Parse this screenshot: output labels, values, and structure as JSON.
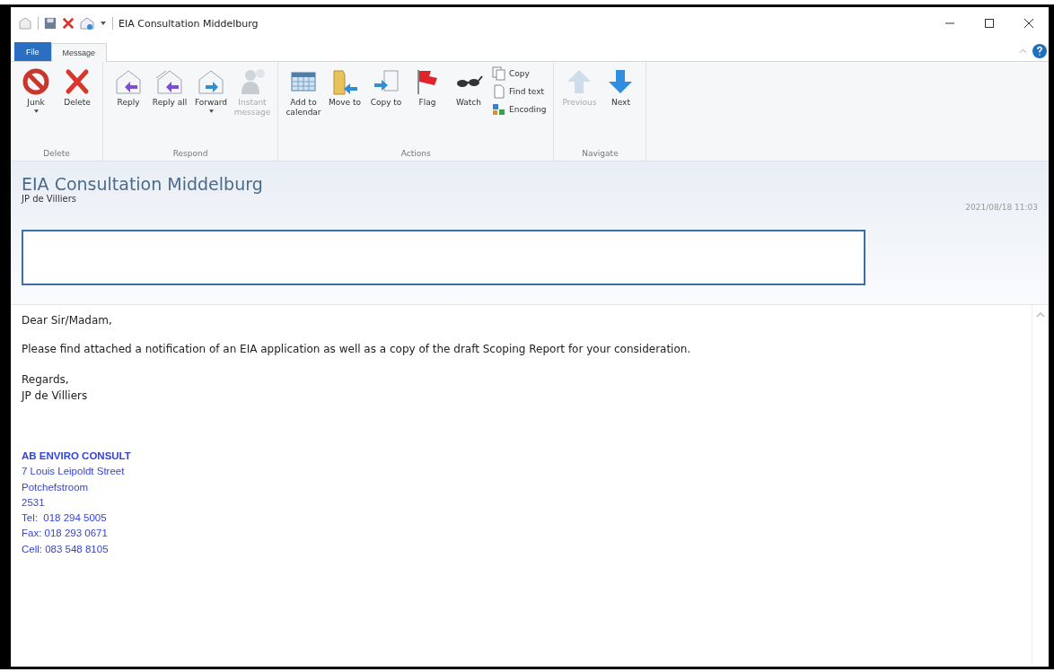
{
  "window": {
    "title": "EIA Consultation Middelburg"
  },
  "tabs": [
    {
      "label": "File",
      "kind": "file",
      "selected": false
    },
    {
      "label": "Message",
      "kind": "tab",
      "selected": true
    }
  ],
  "ribbon_groups": [
    {
      "label": "Delete",
      "buttons": [
        {
          "label": "Junk",
          "kind": "large",
          "dropdown": true,
          "disabled": false
        },
        {
          "label": "Delete",
          "kind": "large",
          "dropdown": false,
          "disabled": false
        }
      ]
    },
    {
      "label": "Respond",
      "buttons": [
        {
          "label": "Reply",
          "kind": "large",
          "dropdown": false,
          "disabled": false
        },
        {
          "label": "Reply all",
          "kind": "large",
          "dropdown": false,
          "disabled": false
        },
        {
          "label": "Forward",
          "kind": "large",
          "dropdown": true,
          "disabled": false
        },
        {
          "label": "Instant message",
          "kind": "large",
          "dropdown": false,
          "disabled": true
        }
      ]
    },
    {
      "label": "Actions",
      "buttons": [
        {
          "label": "Add to calendar",
          "kind": "large",
          "dropdown": false,
          "disabled": false
        },
        {
          "label": "Move to",
          "kind": "large",
          "dropdown": false,
          "disabled": false
        },
        {
          "label": "Copy to",
          "kind": "large",
          "dropdown": false,
          "disabled": false
        },
        {
          "label": "Flag",
          "kind": "large",
          "dropdown": false,
          "disabled": false
        },
        {
          "label": "Watch",
          "kind": "large",
          "dropdown": false,
          "disabled": false
        },
        {
          "label": "Copy",
          "kind": "small",
          "disabled": false
        },
        {
          "label": "Find text",
          "kind": "small",
          "disabled": false
        },
        {
          "label": "Encoding",
          "kind": "small",
          "disabled": false
        }
      ]
    },
    {
      "label": "Navigate",
      "buttons": [
        {
          "label": "Previous",
          "kind": "large",
          "dropdown": false,
          "disabled": true
        },
        {
          "label": "Next",
          "kind": "large",
          "dropdown": false,
          "disabled": false
        }
      ]
    }
  ],
  "message": {
    "subject": "EIA Consultation Middelburg",
    "sender": "JP de Villiers",
    "date": "2021/08/18 11:03"
  },
  "body": [
    "Dear Sir/Madam,",
    "Please find attached a notification of an EIA application as well as a copy of the draft Scoping Report for your consideration."
  ],
  "closing": [
    "Regards,",
    "JP de Villiers"
  ],
  "signature": {
    "company": "AB ENVIRO CONSULT",
    "lines": [
      "7 Louis Leipoldt Street",
      "Potchefstroom",
      "2531",
      "Tel:  018 294 5005",
      "Fax: 018 293 0671",
      "Cell: 083 548 8105"
    ]
  }
}
